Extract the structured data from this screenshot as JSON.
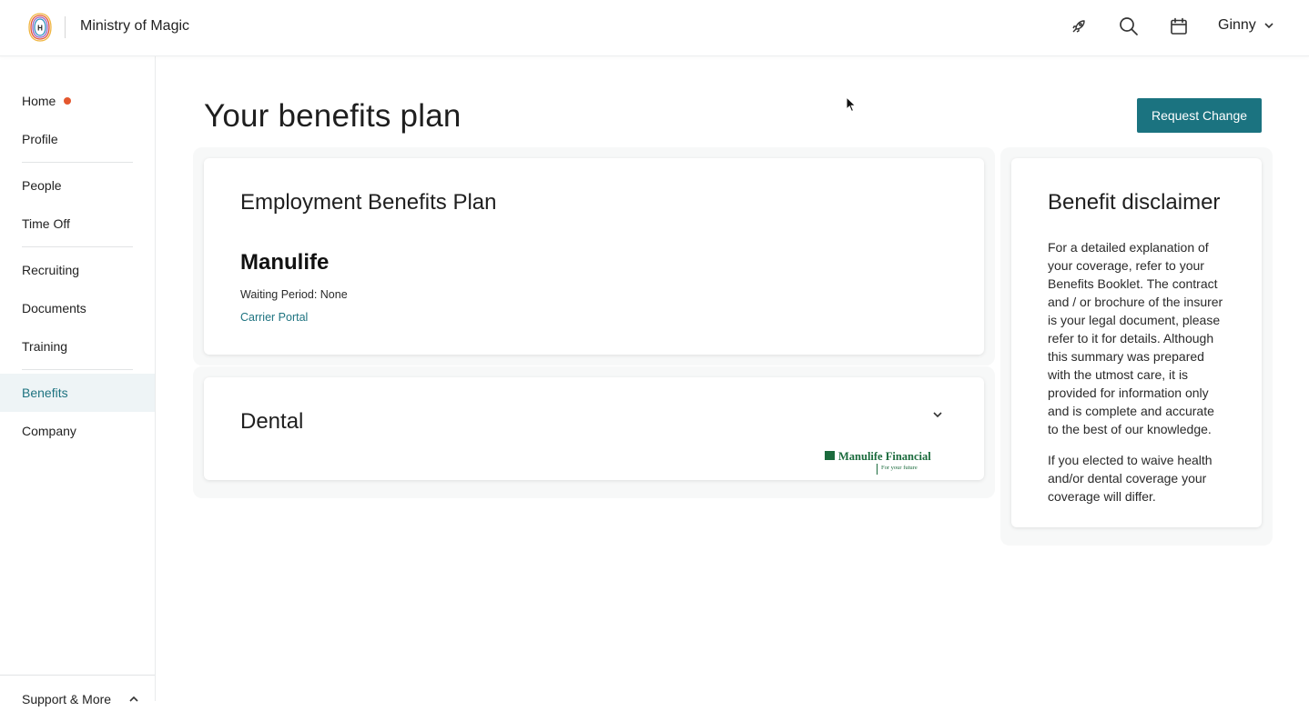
{
  "header": {
    "org_name": "Ministry of Magic",
    "logo_letter": "H",
    "icons": [
      "rocket-icon",
      "search-icon",
      "calendar-icon"
    ],
    "user_name": "Ginny"
  },
  "sidebar": {
    "items": [
      {
        "label": "Home",
        "notification_dot": true
      },
      {
        "label": "Profile"
      },
      {
        "label": "People"
      },
      {
        "label": "Time Off"
      },
      {
        "label": "Recruiting"
      },
      {
        "label": "Documents"
      },
      {
        "label": "Training"
      },
      {
        "label": "Benefits",
        "active": true
      },
      {
        "label": "Company"
      }
    ],
    "support_label": "Support & More"
  },
  "main": {
    "title": "Your benefits plan",
    "request_button": "Request Change",
    "plan_card": {
      "title": "Employment Benefits Plan",
      "carrier": "Manulife",
      "waiting_period": "Waiting Period: None",
      "portal_link": "Carrier Portal"
    },
    "dental_card": {
      "title": "Dental",
      "logo_name": "Manulife Financial",
      "logo_tagline": "For your future"
    },
    "disclaimer": {
      "title": "Benefit disclaimer",
      "paragraph1": "For a detailed explanation of your coverage, refer to your Benefits Booklet. The contract and / or brochure of the insurer is your legal document, please refer to it for details. Although this summary was prepared with the utmost care, it is provided for information only and is complete and accurate to the best of our knowledge.",
      "paragraph2": "If you elected to waive health and/or dental coverage your coverage will differ."
    }
  },
  "colors": {
    "accent": "#1b7380",
    "notification": "#e4572e",
    "active_nav_bg": "#eef4f6"
  }
}
